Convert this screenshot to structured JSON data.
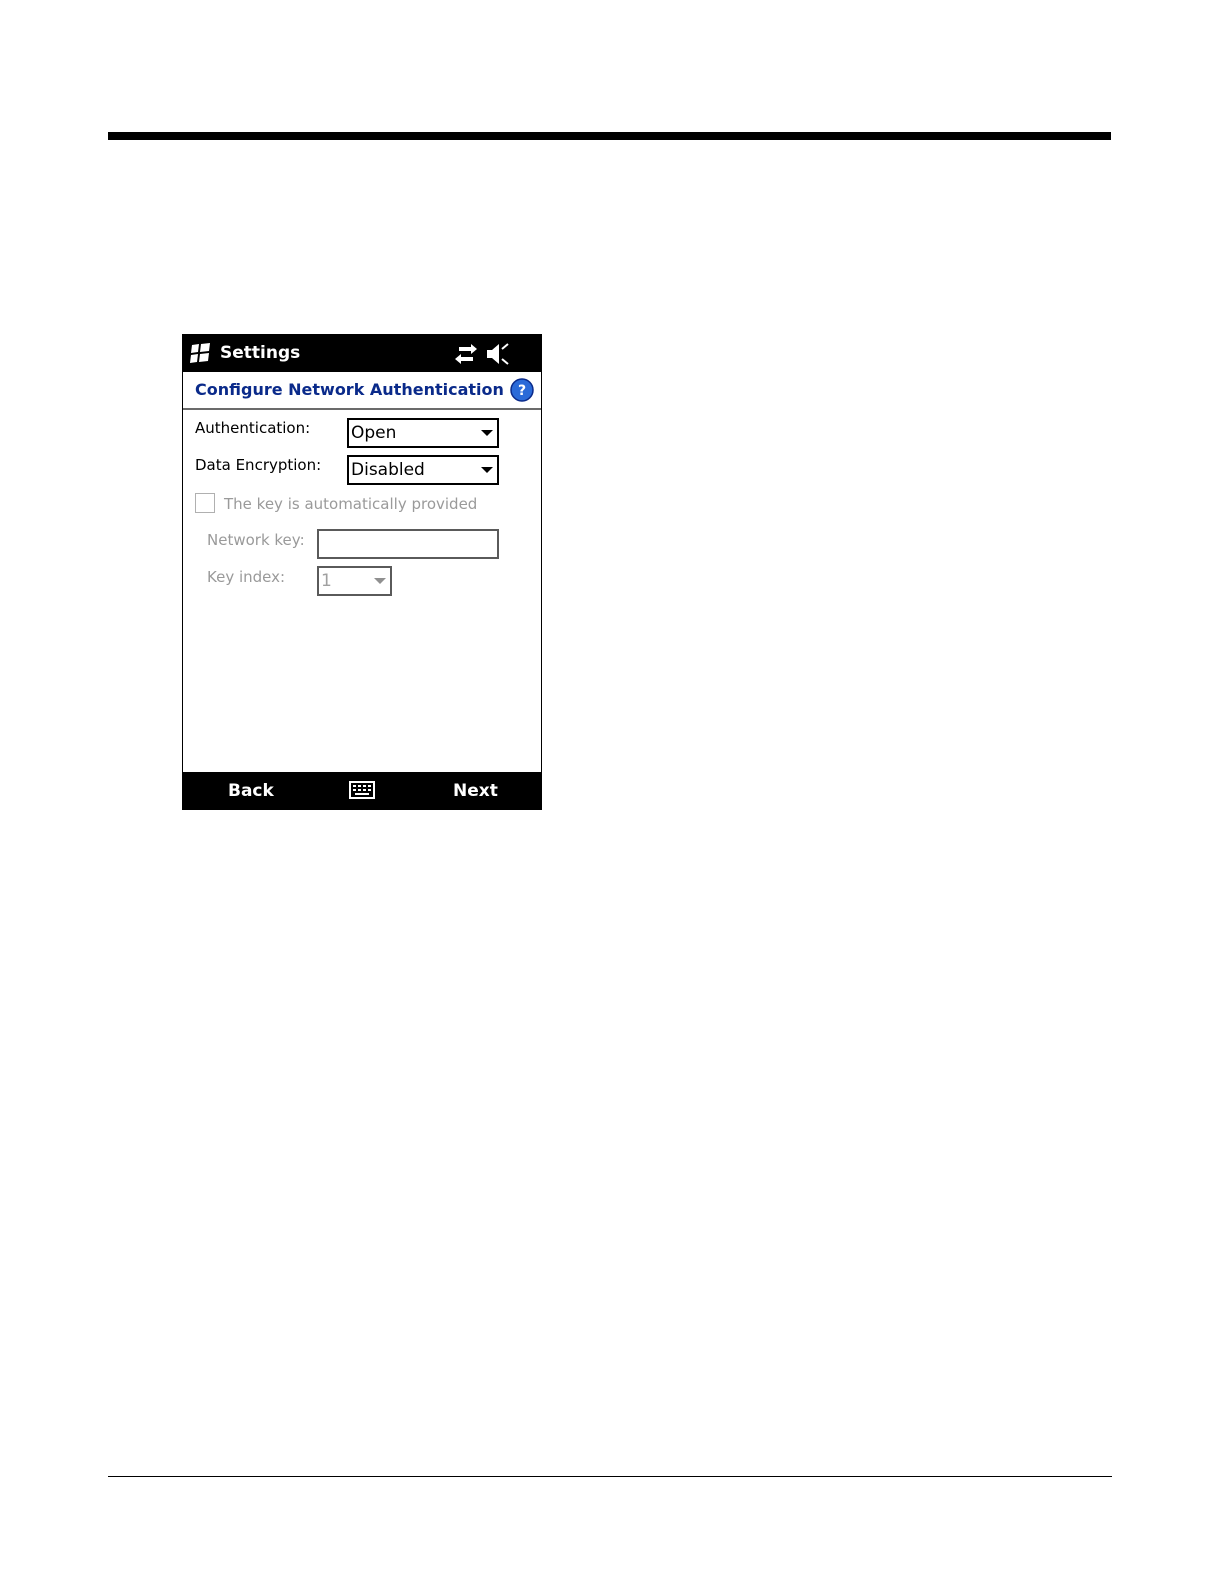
{
  "titlebar": {
    "title": "Settings"
  },
  "header": {
    "heading": "Configure Network Authentication"
  },
  "form": {
    "authentication_label": "Authentication:",
    "authentication_value": "Open",
    "encryption_label": "Data Encryption:",
    "encryption_value": "Disabled",
    "auto_key_label": "The key is automatically provided",
    "network_key_label": "Network key:",
    "network_key_value": "",
    "key_index_label": "Key index:",
    "key_index_value": "1"
  },
  "softkeys": {
    "left": "Back",
    "right": "Next"
  },
  "icons": {
    "windows": "windows-logo-icon",
    "sync": "sync-arrows-icon",
    "speaker": "speaker-icon",
    "help": "help-icon",
    "keyboard": "keyboard-icon"
  },
  "colors": {
    "heading": "#0a2a8a",
    "help": "#2a6ad8",
    "bar": "#000000"
  }
}
